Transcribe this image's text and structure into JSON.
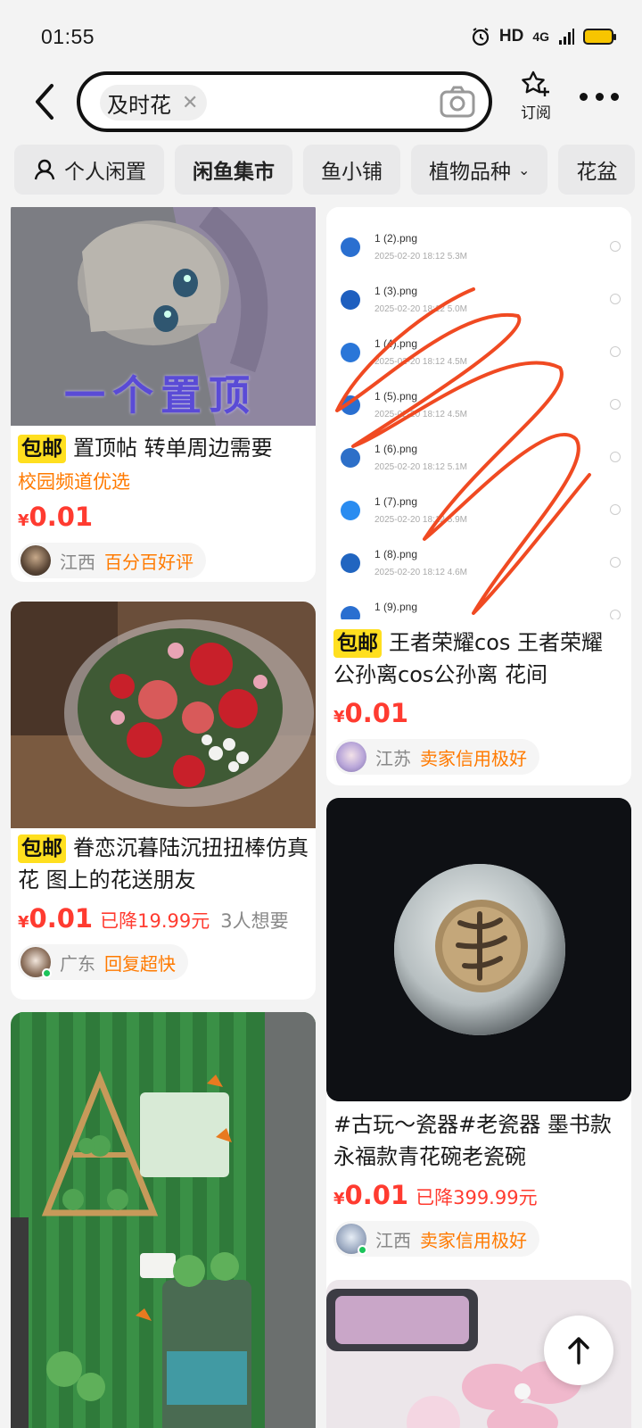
{
  "status": {
    "time": "01:55",
    "hd": "HD",
    "network": "4G"
  },
  "search": {
    "query": "及时花",
    "subscribe_label": "订阅"
  },
  "tabs": [
    {
      "label": "个人闲置"
    },
    {
      "label": "闲鱼集市"
    },
    {
      "label": "鱼小铺"
    },
    {
      "label": "植物品种"
    },
    {
      "label": "花盆"
    }
  ],
  "cards": [
    {
      "image_text": "一个置顶",
      "badge": "包邮",
      "title": "置顶帖 转单周边需要",
      "tag": "校园频道优选",
      "price_symbol": "¥",
      "price": "0.01",
      "region": "江西",
      "seller_tag": "百分百好评"
    },
    {
      "image_files": [
        {
          "name": "1 (2).png",
          "date": "2025-02-20 18:12",
          "size": "5.3M"
        },
        {
          "name": "1 (3).png",
          "date": "2025-02-20 18:12",
          "size": "5.0M"
        },
        {
          "name": "1 (4).png",
          "date": "2025-02-20 18:12",
          "size": "4.5M"
        },
        {
          "name": "1 (5).png",
          "date": "2025-02-20 18:12",
          "size": "4.5M"
        },
        {
          "name": "1 (6).png",
          "date": "2025-02-20 18:12",
          "size": "5.1M"
        },
        {
          "name": "1 (7).png",
          "date": "2025-02-20 18:12",
          "size": "5.9M"
        },
        {
          "name": "1 (8).png",
          "date": "2025-02-20 18:12",
          "size": "4.6M"
        },
        {
          "name": "1 (9).png",
          "date": "",
          "size": ""
        }
      ],
      "badge": "包邮",
      "title": "王者荣耀cos 王者荣耀 公孙离cos公孙离 花间",
      "price_symbol": "¥",
      "price": "0.01",
      "region": "江苏",
      "seller_tag": "卖家信用极好"
    },
    {
      "badge": "包邮",
      "title": "眷恋沉暮陆沉扭扭棒仿真花 图上的花送朋友",
      "price_symbol": "¥",
      "price": "0.01",
      "price_drop": "已降19.99元",
      "want": "3人想要",
      "region": "广东",
      "seller_tag": "回复超快"
    },
    {
      "title": "#古玩～瓷器#老瓷器 墨书款永福款青花碗老瓷碗",
      "price_symbol": "¥",
      "price": "0.01",
      "price_drop": "已降399.99元",
      "region": "江西",
      "seller_tag": "卖家信用极好"
    }
  ]
}
